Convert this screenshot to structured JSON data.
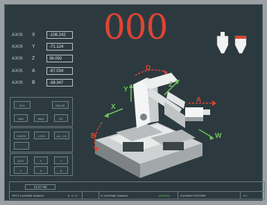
{
  "counter": "000",
  "axes": [
    {
      "word": "AXIS",
      "letter": "X",
      "value": "-106.242"
    },
    {
      "word": "AXIS",
      "letter": "Y",
      "value": "-71.124"
    },
    {
      "word": "AXIS",
      "letter": "Z",
      "value": "36.092"
    },
    {
      "word": "AXIS",
      "letter": "A",
      "value": "-67.034"
    },
    {
      "word": "AXIS",
      "letter": "B",
      "value": "-38.347"
    }
  ],
  "machine_labels": {
    "d": "D",
    "x": "X",
    "y": "Y",
    "z": "Z",
    "a": "A",
    "b": "B",
    "w": "W"
  },
  "controls": {
    "group1": [
      "ETC",
      "PAUSE",
      "MIN",
      "MAX",
      "OK"
    ],
    "group2": [
      "CHECK",
      "LOCK",
      "ALL_OV"
    ],
    "group3": [
      "EXIT",
      "X",
      "Y",
      "Z",
      "A",
      "B"
    ]
  },
  "status": {
    "time": "11:57:46",
    "spot_label": "SPOT KILERME ZAMANI",
    "spot_value": "0 : 0 : 0",
    "ic_label": "IC KILERME ZAMANI",
    "ic_value": "00:00:00",
    "new_label": "KILENEM TESTERE",
    "new_value": "304"
  },
  "colors": {
    "background": "#2c3a3f",
    "accent_red": "#e04433",
    "accent_green": "#6fc25a",
    "text": "#cfd8da"
  }
}
